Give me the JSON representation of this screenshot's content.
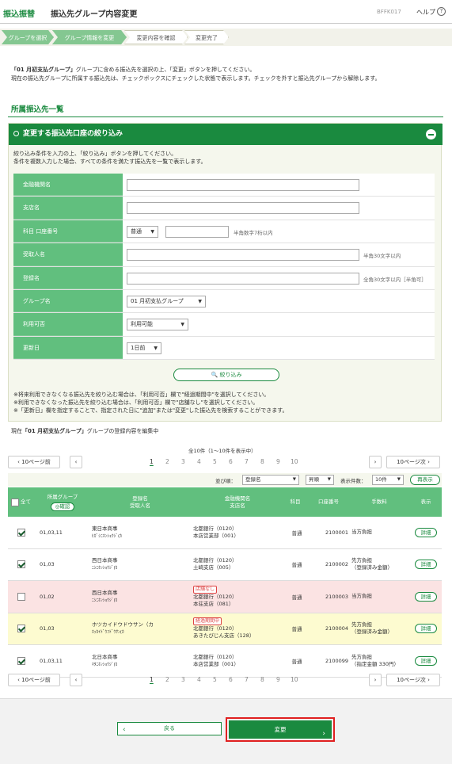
{
  "header": {
    "app": "振込振替",
    "title": "振込先グループ内容変更",
    "code": "BFFK017",
    "help": "ヘルプ",
    "help_icon": "?"
  },
  "steps": [
    "グループを選択",
    "グループ情報を変更",
    "変更内容を確認",
    "変更完了"
  ],
  "intro": {
    "group": "「01 月初支払グループ」",
    "line1": "グループに含める振込先を選択の上、「変更」ボタンを押してください。",
    "line2": "現在の振込先グループに所属する振込先は、チェックボックスにチェックした状態で表示します。チェックを外すと振込先グループから解除します。"
  },
  "section_title": "所属振込先一覧",
  "filter": {
    "header": "変更する振込先口座の絞り込み",
    "desc1": "絞り込み条件を入力の上、「絞り込み」ボタンを押してください。",
    "desc2": "条件を複数入力した場合、すべての条件を満たす振込先を一覧で表示します。",
    "labels": [
      "金融機関名",
      "支店名",
      "科目 口座番号",
      "受取人名",
      "登録名",
      "グループ名",
      "利用可否",
      "更新日"
    ],
    "subject_select": "普通",
    "account_hint": "半角数字7桁以内",
    "payee_hint": "半角30文字以内",
    "regname_hint": "全角30文字以内［半角可］",
    "group_select": "01 月初支払グループ",
    "usable_select": "利用可能",
    "updated_select": "1日前",
    "search_button": "絞り込み",
    "notes": [
      "※将来利用できなくなる振込先を絞り込む場合は、「利用可否」欄で\"経過期間中\"を選択してください。",
      "※利用できなくなった振込先を絞り込む場合は、「利用可否」欄で\"店舗なし\"を選択してください。",
      "※「更新日」欄を指定することで、指定された日に\"追加\"または\"変更\"した振込先を検索することができます。"
    ]
  },
  "current": {
    "prefix": "現在",
    "group": "「01 月初支払グループ」",
    "suffix": "グループの登録内容を編集中"
  },
  "paging": {
    "range": "全10件（1～10件を表示中）",
    "prev10": "10ページ前",
    "next10": "10ページ次",
    "pages": [
      "1",
      "2",
      "3",
      "4",
      "5",
      "6",
      "7",
      "8",
      "9",
      "10"
    ]
  },
  "sort": {
    "label": "並び順：",
    "key": "登録名",
    "order": "昇順",
    "count_label": "表示件数：",
    "count": "10件",
    "redisplay": "再表示"
  },
  "table": {
    "headers": {
      "all": "全て",
      "group": "所属グループ",
      "confirm": "確認",
      "name": "登録名",
      "payee": "受取人名",
      "bank": "金融機関名",
      "branch": "支店名",
      "subject": "科目",
      "account": "口座番号",
      "fee": "手数料",
      "show": "表示"
    },
    "rows": [
      {
        "checked": true,
        "group": "01,03,11",
        "name": "東日本商事",
        "kana": "ﾋｶﾞｼﾆﾎﾝｼｮｳｼﾞ(ｶ",
        "tag": "",
        "bank": "北都銀行（0120）",
        "branch": "本店営業部（001）",
        "subject": "普通",
        "account": "2100001",
        "fee1": "当方負担",
        "fee2": "",
        "detail": "詳細",
        "bg": "#ffffff"
      },
      {
        "checked": true,
        "group": "01,03",
        "name": "西日本商事",
        "kana": "ﾆｼﾆﾎﾝｼｮｳｼﾞ(ｶ",
        "tag": "",
        "bank": "北都銀行（0120）",
        "branch": "土崎支店（005）",
        "subject": "普通",
        "account": "2100002",
        "fee1": "先方負担",
        "fee2": "（登録済み金額）",
        "detail": "詳細",
        "bg": "#ffffff"
      },
      {
        "checked": false,
        "group": "01,02",
        "name": "西日本商事",
        "kana": "ﾆｼﾆﾎﾝｼｮｳｼﾞ(ｶ",
        "tag": "店舗なし",
        "bank": "北都銀行（0120）",
        "branch": "本荘支店（081）",
        "subject": "普通",
        "account": "2100003",
        "fee1": "当方負担",
        "fee2": "",
        "detail": "詳細",
        "bg": "#fbe3e3"
      },
      {
        "checked": true,
        "group": "01,03",
        "name": "ホツカイドウドウサン（カ",
        "kana": "ﾎｯｶｲﾄﾞｳﾌﾄﾞｳｻﾝ(ｶ",
        "tag": "経過期間中",
        "bank": "北都銀行（0120）",
        "branch": "あきたびじん支店（128）",
        "subject": "普通",
        "account": "2100004",
        "fee1": "先方負担",
        "fee2": "（登録済み金額）",
        "detail": "詳細",
        "bg": "#fdfbd0"
      },
      {
        "checked": true,
        "group": "01,03,11",
        "name": "北日本商事",
        "kana": "ｷﾀﾆﾎﾝｼｮｳｼﾞ(ｶ",
        "tag": "",
        "bank": "北都銀行（0120）",
        "branch": "本店営業部（001）",
        "subject": "普通",
        "account": "2100099",
        "fee1": "先方負担",
        "fee2": "（指定金額 330円）",
        "detail": "詳細",
        "bg": "#ffffff"
      }
    ]
  },
  "buttons": {
    "back": "戻る",
    "next": "変更"
  }
}
